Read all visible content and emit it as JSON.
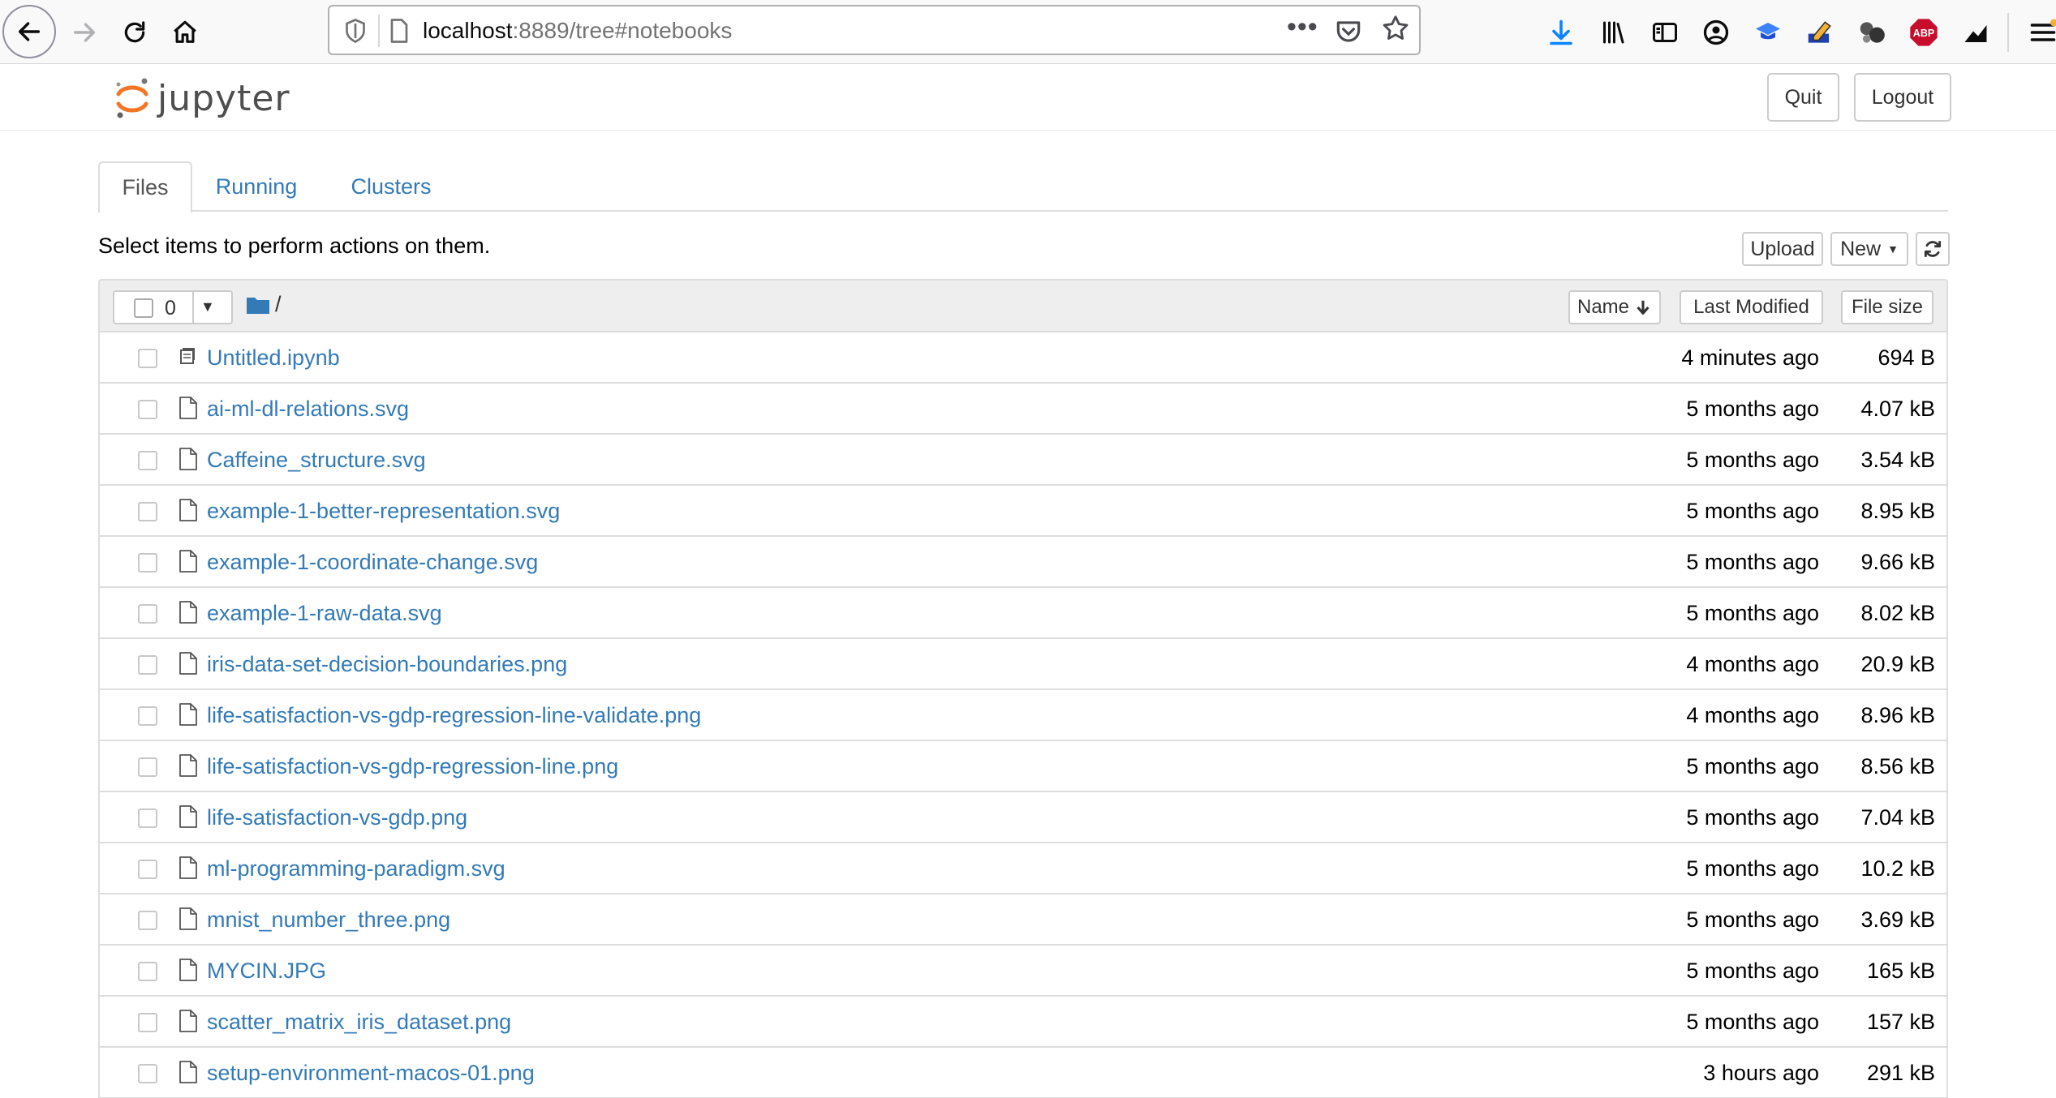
{
  "browser": {
    "url_host": "localhost",
    "url_rest": ":8889/tree#notebooks",
    "more_icon": "ellipsis-icon",
    "abp_label": "ABP"
  },
  "header": {
    "logo_text": "jupyter",
    "quit_label": "Quit",
    "logout_label": "Logout"
  },
  "tabs": [
    {
      "label": "Files",
      "active": true
    },
    {
      "label": "Running",
      "active": false
    },
    {
      "label": "Clusters",
      "active": false
    }
  ],
  "toolbar": {
    "instructions": "Select items to perform actions on them.",
    "upload_label": "Upload",
    "new_label": "New"
  },
  "list_header": {
    "selected_count": "0",
    "breadcrumb": "/",
    "sort_name_label": "Name",
    "sort_modified_label": "Last Modified",
    "sort_size_label": "File size"
  },
  "files": [
    {
      "name": "Untitled.ipynb",
      "modified": "4 minutes ago",
      "size": "694 B",
      "type": "notebook"
    },
    {
      "name": "ai-ml-dl-relations.svg",
      "modified": "5 months ago",
      "size": "4.07 kB",
      "type": "file"
    },
    {
      "name": "Caffeine_structure.svg",
      "modified": "5 months ago",
      "size": "3.54 kB",
      "type": "file"
    },
    {
      "name": "example-1-better-representation.svg",
      "modified": "5 months ago",
      "size": "8.95 kB",
      "type": "file"
    },
    {
      "name": "example-1-coordinate-change.svg",
      "modified": "5 months ago",
      "size": "9.66 kB",
      "type": "file"
    },
    {
      "name": "example-1-raw-data.svg",
      "modified": "5 months ago",
      "size": "8.02 kB",
      "type": "file"
    },
    {
      "name": "iris-data-set-decision-boundaries.png",
      "modified": "4 months ago",
      "size": "20.9 kB",
      "type": "file"
    },
    {
      "name": "life-satisfaction-vs-gdp-regression-line-validate.png",
      "modified": "4 months ago",
      "size": "8.96 kB",
      "type": "file"
    },
    {
      "name": "life-satisfaction-vs-gdp-regression-line.png",
      "modified": "5 months ago",
      "size": "8.56 kB",
      "type": "file"
    },
    {
      "name": "life-satisfaction-vs-gdp.png",
      "modified": "5 months ago",
      "size": "7.04 kB",
      "type": "file"
    },
    {
      "name": "ml-programming-paradigm.svg",
      "modified": "5 months ago",
      "size": "10.2 kB",
      "type": "file"
    },
    {
      "name": "mnist_number_three.png",
      "modified": "5 months ago",
      "size": "3.69 kB",
      "type": "file"
    },
    {
      "name": "MYCIN.JPG",
      "modified": "5 months ago",
      "size": "165 kB",
      "type": "file"
    },
    {
      "name": "scatter_matrix_iris_dataset.png",
      "modified": "5 months ago",
      "size": "157 kB",
      "type": "file"
    },
    {
      "name": "setup-environment-macos-01.png",
      "modified": "3 hours ago",
      "size": "291 kB",
      "type": "file"
    }
  ],
  "colors": {
    "link": "#337ab7",
    "jupyter_orange": "#f37626",
    "folder_blue": "#337ab7"
  }
}
